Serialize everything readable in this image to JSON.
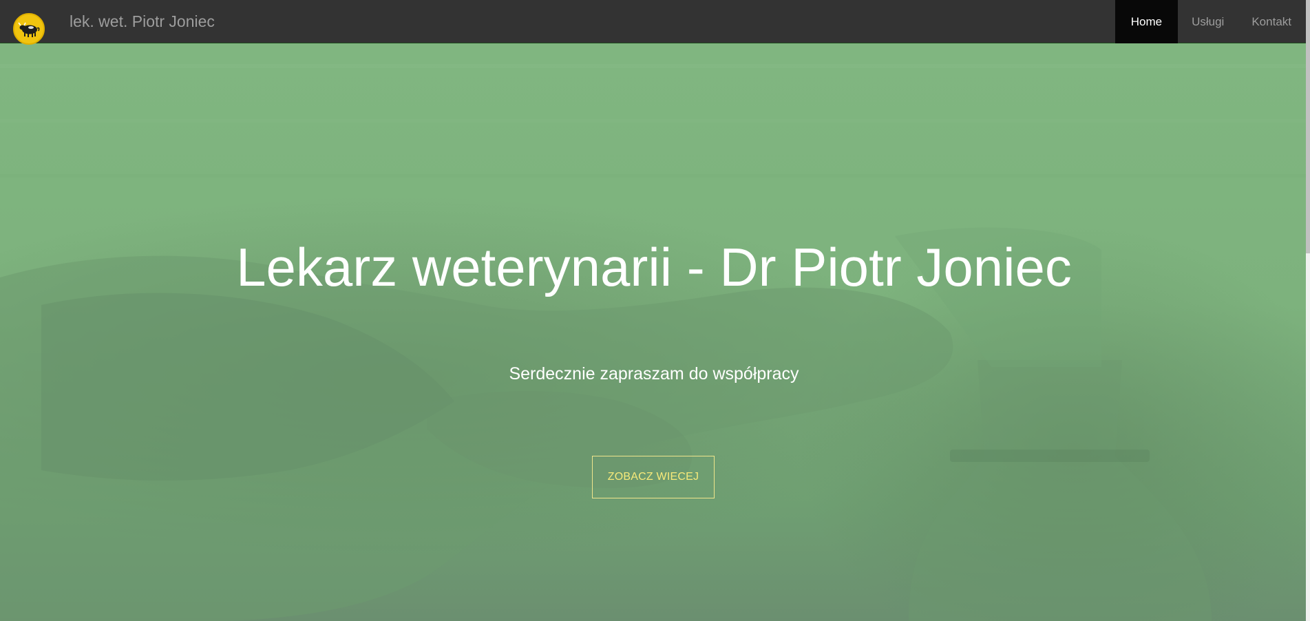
{
  "navbar": {
    "brand": "lek. wet. Piotr Joniec",
    "logo_icon": "vet-logo-icon",
    "items": [
      {
        "label": "Home",
        "active": true
      },
      {
        "label": "Usługi",
        "active": false
      },
      {
        "label": "Kontakt",
        "active": false
      }
    ]
  },
  "hero": {
    "title": "Lekarz weterynarii - Dr Piotr Joniec",
    "subtitle": "Serdecznie zapraszam do współpracy",
    "cta_label": "ZOBACZ WIECEJ"
  },
  "colors": {
    "navbar_bg": "#333333",
    "nav_active_bg": "#080808",
    "hero_overlay": "#7fb47f",
    "cta_accent": "#f0e68c",
    "logo_bg": "#f1c40f"
  }
}
